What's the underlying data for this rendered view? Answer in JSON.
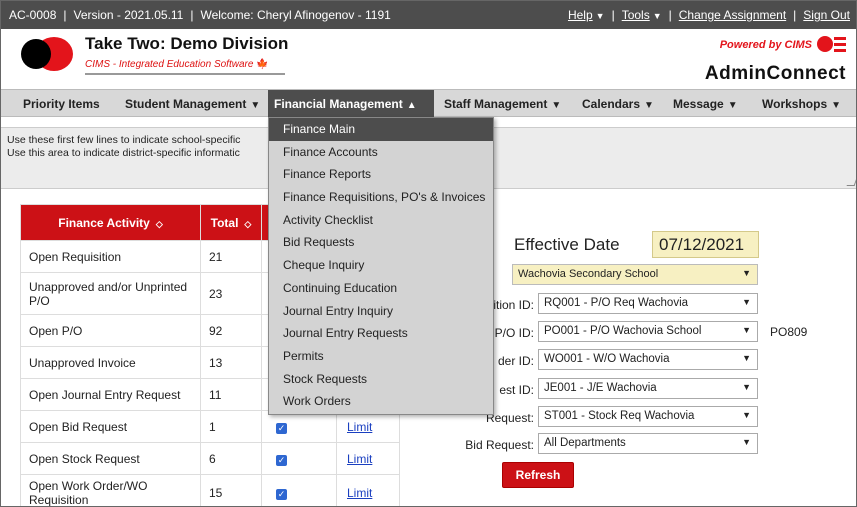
{
  "topbar": {
    "app_code": "AC-0008",
    "version": "Version - 2021.05.11",
    "welcome": "Welcome: Cheryl Afinogenov - 1191",
    "help": "Help",
    "tools": "Tools",
    "change_assignment": "Change Assignment",
    "sign_out": "Sign Out"
  },
  "header": {
    "division": "Take Two: Demo Division",
    "tagline": "CIMS - Integrated Education Software",
    "powered_by": "Powered by CIMS",
    "product": "AdminConnect"
  },
  "nav": {
    "items": [
      {
        "label": "Priority Items",
        "chevron": ""
      },
      {
        "label": "Student Management",
        "chevron": "▼"
      },
      {
        "label": "Financial Management",
        "chevron": "▲"
      },
      {
        "label": "Staff Management",
        "chevron": "▼"
      },
      {
        "label": "Calendars",
        "chevron": "▼"
      },
      {
        "label": "Message",
        "chevron": "▼"
      },
      {
        "label": "Workshops",
        "chevron": "▼"
      }
    ]
  },
  "info": {
    "line1": "Use these first few lines to indicate school-specific",
    "line2": "Use this area to indicate district-specific informatic"
  },
  "activity": {
    "headers": [
      "Finance Activity",
      "Total",
      "",
      ""
    ],
    "rows": [
      {
        "name": "Open Requisition",
        "total": "21",
        "checked": false,
        "limit": ""
      },
      {
        "name": "Unapproved and/or Unprinted P/O",
        "total": "23",
        "checked": false,
        "limit": ""
      },
      {
        "name": "Open P/O",
        "total": "92",
        "checked": false,
        "limit": ""
      },
      {
        "name": "Unapproved Invoice",
        "total": "13",
        "checked": false,
        "limit": ""
      },
      {
        "name": "Open Journal Entry Request",
        "total": "11",
        "checked": false,
        "limit": ""
      },
      {
        "name": "Open Bid Request",
        "total": "1",
        "checked": true,
        "limit": "Limit"
      },
      {
        "name": "Open Stock Request",
        "total": "6",
        "checked": true,
        "limit": "Limit"
      },
      {
        "name": "Open Work Order/WO Requisition",
        "total": "15",
        "checked": true,
        "limit": "Limit"
      }
    ]
  },
  "form": {
    "effective_date_label": "Effective Date",
    "effective_date": "07/12/2021",
    "school": "Wachovia Secondary School",
    "fields": [
      {
        "label": "ition ID:",
        "value": "RQ001 - P/O Req Wachovia"
      },
      {
        "label": "P/O ID:",
        "value": "PO001 - P/O Wachovia School"
      },
      {
        "label": "der ID:",
        "value": "WO001 - W/O Wachovia"
      },
      {
        "label": "est ID:",
        "value": "JE001 - J/E Wachovia"
      },
      {
        "label": "Request:",
        "value": "ST001 - Stock Req Wachovia"
      },
      {
        "label": "Bid Request:",
        "value": "All Departments"
      }
    ],
    "po_ref": "PO809",
    "refresh": "Refresh"
  },
  "dropdown": {
    "items": [
      "Finance Main",
      "Finance Accounts",
      "Finance Reports",
      "Finance Requisitions, PO's & Invoices",
      "Activity Checklist",
      "Bid Requests",
      "Cheque Inquiry",
      "Continuing Education",
      "Journal Entry Inquiry",
      "Journal Entry Requests",
      "Permits",
      "Stock Requests",
      "Work Orders"
    ],
    "highlighted": "Finance Main"
  }
}
